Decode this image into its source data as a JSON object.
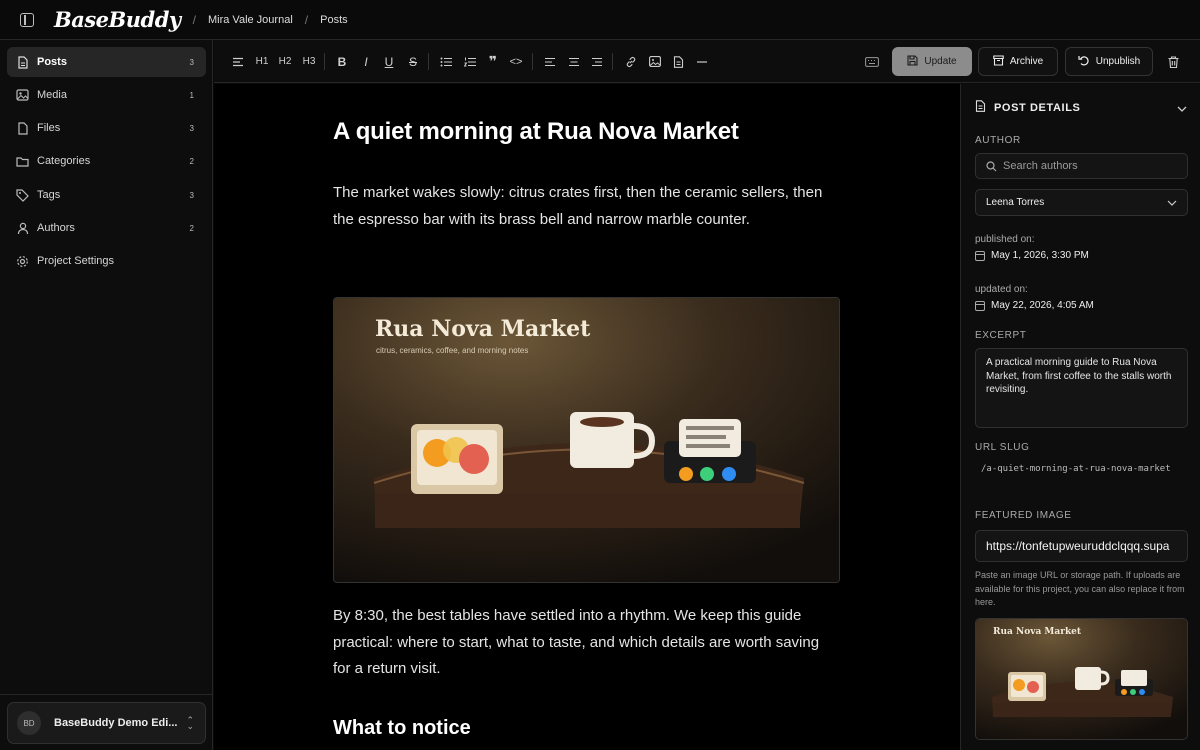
{
  "topbar": {
    "brand": "BaseBuddy",
    "breadcrumbs": [
      "Mira Vale Journal",
      "Posts"
    ]
  },
  "sidebar": {
    "items": [
      {
        "label": "Posts",
        "count": "3",
        "icon": "posts-icon",
        "active": true
      },
      {
        "label": "Media",
        "count": "1",
        "icon": "image-icon"
      },
      {
        "label": "Files",
        "count": "3",
        "icon": "file-icon"
      },
      {
        "label": "Categories",
        "count": "2",
        "icon": "folder-icon"
      },
      {
        "label": "Tags",
        "count": "3",
        "icon": "tag-icon"
      },
      {
        "label": "Authors",
        "count": "2",
        "icon": "user-icon"
      },
      {
        "label": "Project Settings",
        "count": "",
        "icon": "gear-icon"
      }
    ],
    "account": {
      "initials": "BD",
      "name": "BaseBuddy Demo Edi..."
    }
  },
  "toolbar": {
    "update_label": "Update",
    "archive_label": "Archive",
    "unpublish_label": "Unpublish",
    "heading_labels": [
      "H1",
      "H2",
      "H3"
    ]
  },
  "post": {
    "title": "A quiet morning at Rua Nova Market",
    "para1": "The market wakes slowly: citrus crates first, then the ceramic sellers, then the espresso bar with its brass bell and narrow marble counter.",
    "para2": "By 8:30, the best tables have settled into a rhythm. We keep this guide practical: where to start, what to taste, and which details are worth saving for a return visit.",
    "heading2": "What to notice",
    "image": {
      "title": "Rua Nova Market",
      "subtitle": "citrus, ceramics, coffee, and morning notes"
    }
  },
  "panel": {
    "title": "POST DETAILS",
    "author_label": "AUTHOR",
    "search_placeholder": "Search authors",
    "selected_author": "Leena Torres",
    "published_label": "published on:",
    "published_value": "May 1, 2026, 3:30 PM",
    "updated_label": "updated on:",
    "updated_value": "May 22, 2026, 4:05 AM",
    "excerpt_label": "EXCERPT",
    "excerpt": "A practical morning guide to Rua Nova Market, from first coffee to the stalls worth revisiting.",
    "slug_label": "URL SLUG",
    "slug": "/a-quiet-morning-at-rua-nova-market",
    "featured_label": "FEATURED IMAGE",
    "featured_url": "https://tonfetupweuruddclqqq.supa",
    "featured_hint": "Paste an image URL or storage path. If uploads are available for this project, you can also replace it from here.",
    "thumb_title": "Rua Nova Market"
  },
  "colors": {
    "background": "#0a0a0a",
    "surface": "#0d0d0d",
    "accent_grey": "#8c8c8c",
    "dot_orange": "#f39c1f",
    "dot_green": "#3ecf7a",
    "dot_blue": "#2f8cf0"
  }
}
